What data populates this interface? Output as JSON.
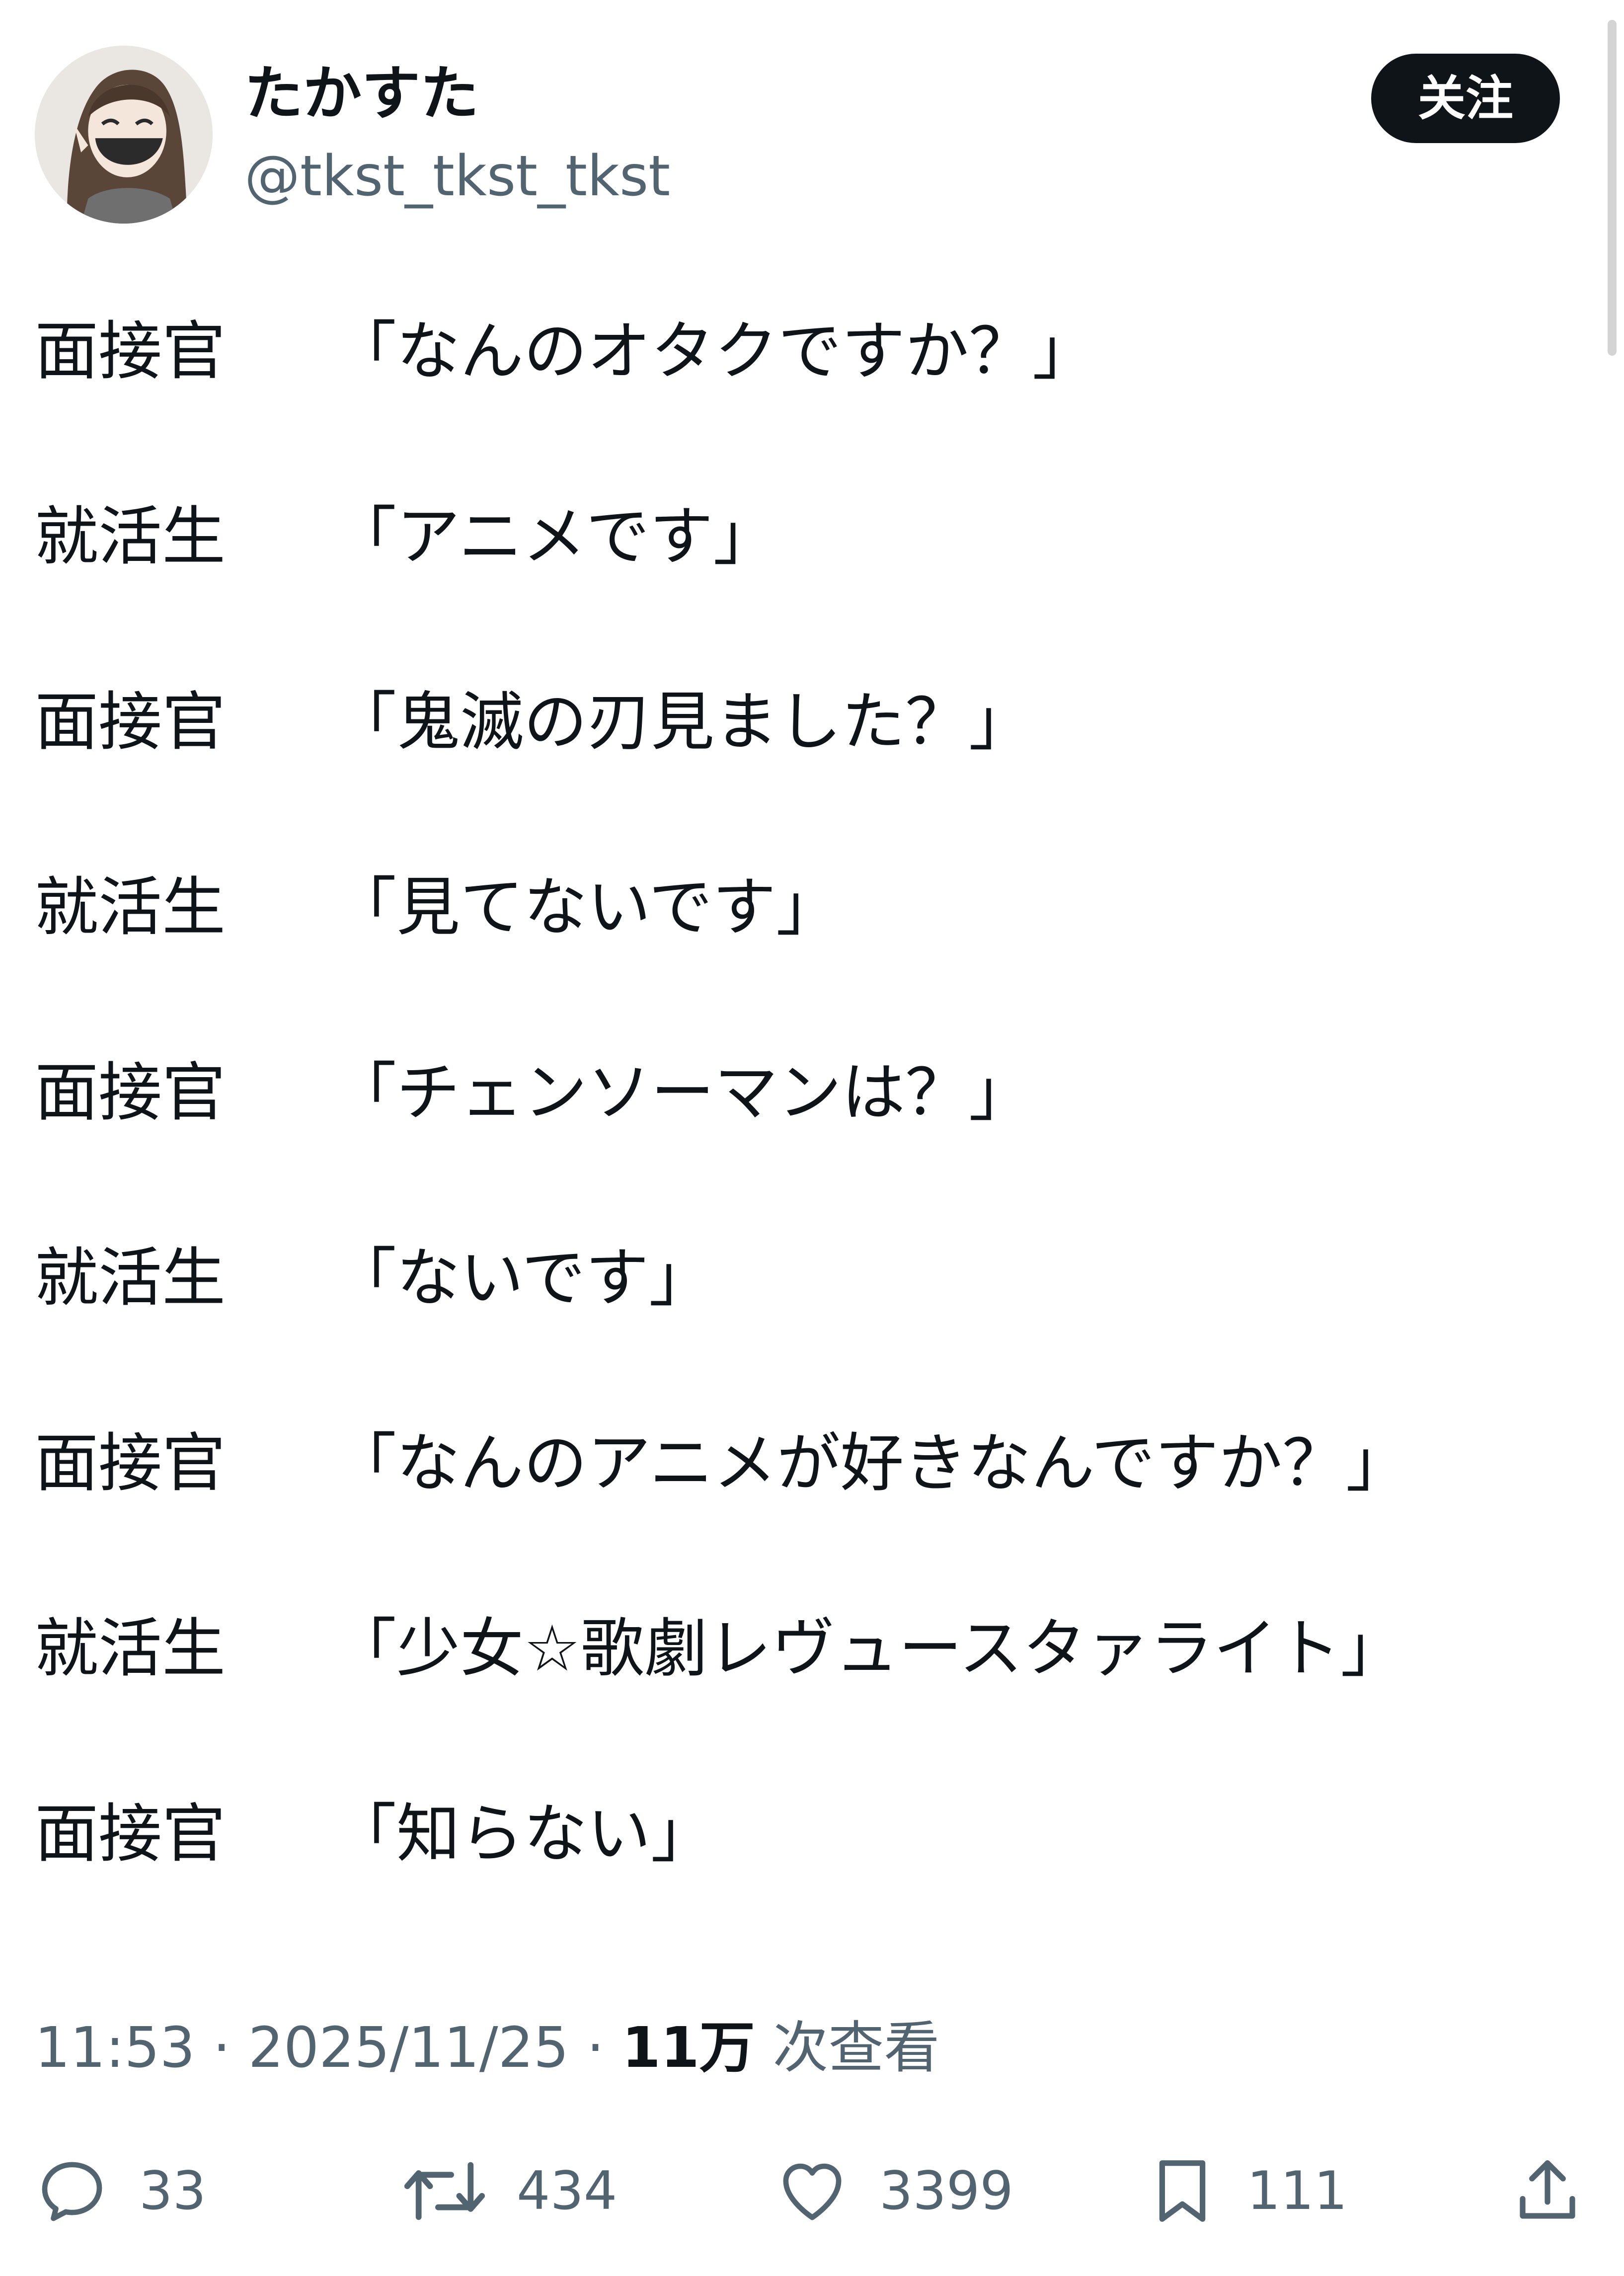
{
  "tweet": {
    "display_name": "たかすた",
    "handle": "@tkst_tkst_tkst",
    "follow_label": "关注",
    "lines": [
      {
        "speaker": "面接官",
        "text": "「なんのオタクですか？」"
      },
      {
        "speaker": "就活生",
        "text": "「アニメです」"
      },
      {
        "speaker": "面接官",
        "text": "「鬼滅の刃見ました？」"
      },
      {
        "speaker": "就活生",
        "text": "「見てないです」"
      },
      {
        "speaker": "面接官",
        "text": "「チェンソーマンは？」"
      },
      {
        "speaker": "就活生",
        "text": "「ないです」"
      },
      {
        "speaker": "面接官",
        "text": "「なんのアニメが好きなんですか？」"
      },
      {
        "speaker": "就活生",
        "text": "「少女☆歌劇レヴュースタァライト」"
      },
      {
        "speaker": "面接官",
        "text": "「知らない」"
      }
    ],
    "time": "11:53",
    "date": "2025/11/25",
    "views_count": "11万",
    "views_label": "次查看"
  },
  "actions": {
    "reply": {
      "icon": "reply-icon",
      "count": "33"
    },
    "retweet": {
      "icon": "retweet-icon",
      "count": "434"
    },
    "like": {
      "icon": "heart-icon",
      "count": "3399"
    },
    "bookmark": {
      "icon": "bookmark-icon",
      "count": "111"
    },
    "share": {
      "icon": "share-icon"
    }
  },
  "colors": {
    "text": "#0f1419",
    "secondary": "#536471",
    "follow_bg": "#0f1419",
    "follow_text": "#ffffff"
  }
}
